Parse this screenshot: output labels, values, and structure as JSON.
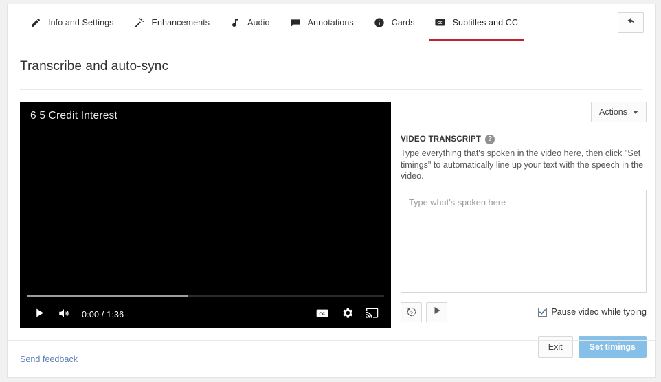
{
  "tabs": [
    {
      "label": "Info and Settings",
      "icon": "pencil-icon",
      "active": false
    },
    {
      "label": "Enhancements",
      "icon": "magic-wand-icon",
      "active": false
    },
    {
      "label": "Audio",
      "icon": "music-note-icon",
      "active": false
    },
    {
      "label": "Annotations",
      "icon": "speech-bubble-icon",
      "active": false
    },
    {
      "label": "Cards",
      "icon": "info-circle-icon",
      "active": false
    },
    {
      "label": "Subtitles and CC",
      "icon": "cc-icon",
      "active": true
    }
  ],
  "header": {
    "back_button_label": "",
    "back_icon": "back-arrow-icon"
  },
  "page": {
    "title": "Transcribe and auto-sync"
  },
  "video": {
    "title": "6 5 Credit Interest",
    "current_time": "0:00",
    "duration": "1:36",
    "time_display": "0:00 / 1:36",
    "progress_percent": 0,
    "loaded_percent": 45,
    "controls": {
      "play": "play-icon",
      "volume": "volume-icon",
      "captions": "cc-icon",
      "settings": "gear-icon",
      "cast": "cast-icon"
    }
  },
  "panel": {
    "actions_label": "Actions",
    "section_label": "VIDEO TRANSCRIPT",
    "help_glyph": "?",
    "description": "Type everything that's spoken in the video here, then click \"Set timings\" to automatically line up your text with the speech in the video.",
    "transcript_value": "",
    "transcript_placeholder": "Type what's spoken here",
    "rewind_label": "5",
    "pause_checkbox_label": "Pause video while typing",
    "pause_checkbox_checked": true,
    "exit_label": "Exit",
    "set_timings_label": "Set timings"
  },
  "footer": {
    "feedback_label": "Send feedback"
  },
  "colors": {
    "accent_red": "#bb2430",
    "primary_button": "#86c0e8",
    "link_blue": "#5b7fb9"
  }
}
